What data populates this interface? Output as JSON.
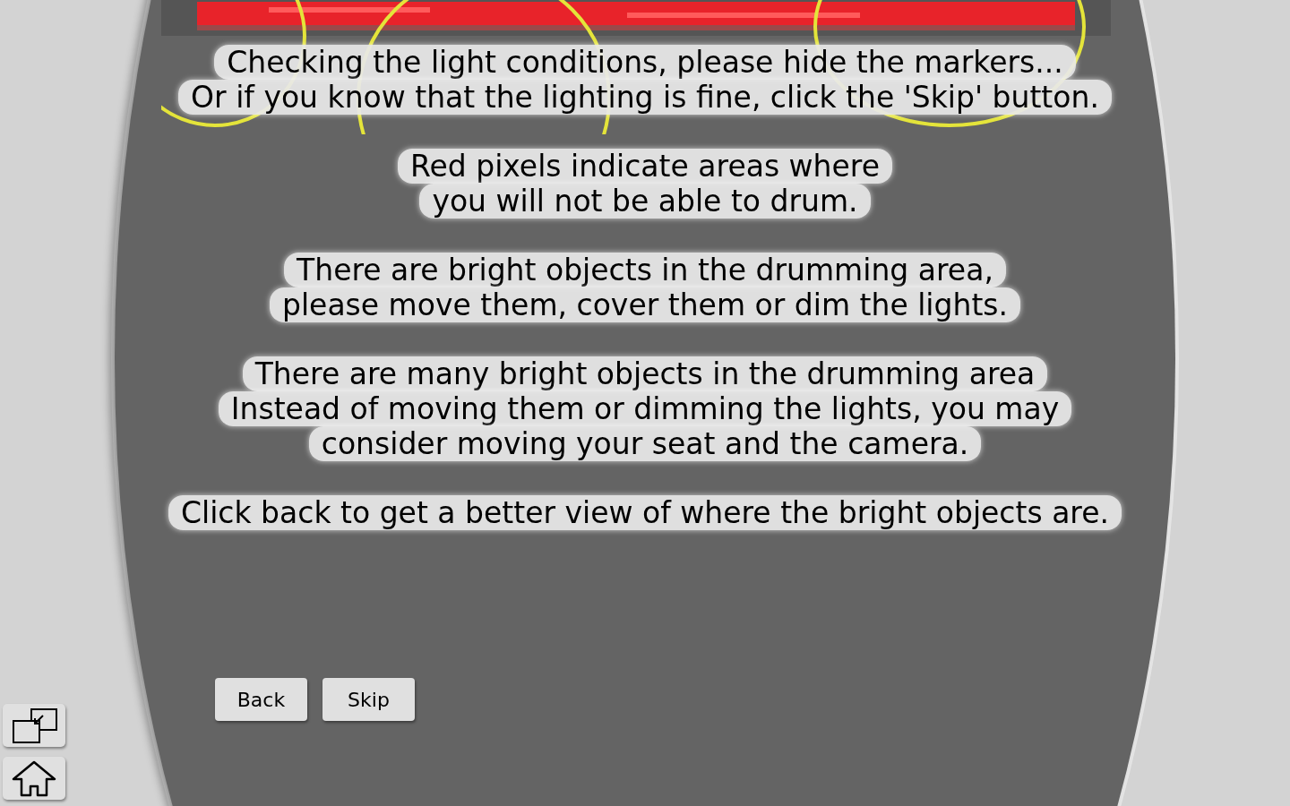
{
  "camera_view": {
    "kind": "picture"
  },
  "messages": [
    {
      "lines": [
        "Checking the light conditions, please hide the markers...",
        "Or if you know that the lighting is fine, click the 'Skip' button."
      ]
    },
    {
      "lines": [
        "Red pixels indicate areas where",
        "you will not be able to drum."
      ]
    },
    {
      "lines": [
        "There are bright objects in the drumming area,",
        "please move them, cover them or dim the lights."
      ]
    },
    {
      "lines": [
        "There are many bright objects in the drumming area",
        "Instead of moving them or dimming the lights, you may",
        "consider moving your seat and the camera."
      ]
    },
    {
      "lines": [
        "Click back to get a better view of where the bright objects are."
      ]
    }
  ],
  "buttons": [
    "Back",
    "Skip"
  ],
  "corner_buttons": [
    {
      "kind": "window"
    },
    {
      "kind": "home"
    }
  ]
}
